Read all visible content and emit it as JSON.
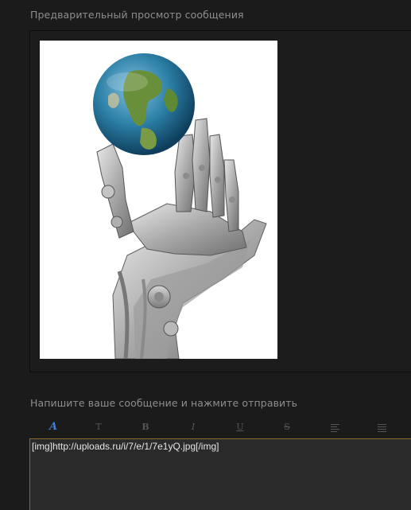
{
  "preview": {
    "title": "Предварительный просмотр сообщения",
    "image_alt": "robot-hand-holding-globe"
  },
  "compose": {
    "title": "Напишите ваше сообщение и нажмите отправить",
    "message_value": "[img]http://uploads.ru/i/7/e/1/7e1yQ.jpg[/img]"
  },
  "toolbar": {
    "font": "A",
    "size": "T",
    "bold": "B",
    "italic": "I",
    "underline": "U",
    "strike": "S",
    "align_left": "",
    "align_justify": ""
  },
  "colors": {
    "background": "#1b1b1b",
    "text_muted": "#8e8e8e",
    "accent_active_tool": "#3f7fd8",
    "editor_border": "#8a6a2c"
  },
  "icons": [
    "font-icon",
    "text-size-icon",
    "bold-icon",
    "italic-icon",
    "underline-icon",
    "strikethrough-icon",
    "align-left-icon",
    "align-justify-icon"
  ]
}
